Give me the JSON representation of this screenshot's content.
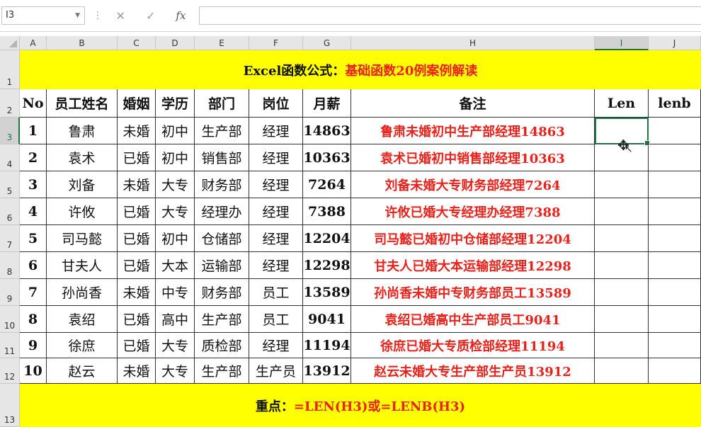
{
  "namebox": "I3",
  "formula": "",
  "fx": "fx",
  "columns": [
    "A",
    "B",
    "C",
    "D",
    "E",
    "F",
    "G",
    "H",
    "I",
    "J"
  ],
  "rows": [
    "1",
    "2",
    "3",
    "4",
    "5",
    "6",
    "7",
    "8",
    "9",
    "10",
    "11",
    "12",
    "13"
  ],
  "title": {
    "black": "Excel函数公式：",
    "red": "基础函数20例案例解读"
  },
  "headers": [
    "No",
    "员工姓名",
    "婚姻",
    "学历",
    "部门",
    "岗位",
    "月薪",
    "备注",
    "Len",
    "lenb"
  ],
  "data": [
    [
      "1",
      "鲁肃",
      "未婚",
      "初中",
      "生产部",
      "经理",
      "14863",
      "鲁肃未婚初中生产部经理14863"
    ],
    [
      "2",
      "袁术",
      "已婚",
      "初中",
      "销售部",
      "经理",
      "10363",
      "袁术已婚初中销售部经理10363"
    ],
    [
      "3",
      "刘备",
      "未婚",
      "大专",
      "财务部",
      "经理",
      "7264",
      "刘备未婚大专财务部经理7264"
    ],
    [
      "4",
      "许攸",
      "已婚",
      "大专",
      "经理办",
      "经理",
      "7388",
      "许攸已婚大专经理办经理7388"
    ],
    [
      "5",
      "司马懿",
      "已婚",
      "初中",
      "仓储部",
      "经理",
      "12204",
      "司马懿已婚初中仓储部经理12204"
    ],
    [
      "6",
      "甘夫人",
      "已婚",
      "大本",
      "运输部",
      "经理",
      "12298",
      "甘夫人已婚大本运输部经理12298"
    ],
    [
      "7",
      "孙尚香",
      "未婚",
      "中专",
      "财务部",
      "员工",
      "13589",
      "孙尚香未婚中专财务部员工13589"
    ],
    [
      "8",
      "袁绍",
      "已婚",
      "高中",
      "生产部",
      "员工",
      "9041",
      "袁绍已婚高中生产部员工9041"
    ],
    [
      "9",
      "徐庶",
      "已婚",
      "大专",
      "质检部",
      "经理",
      "11194",
      "徐庶已婚大专质检部经理11194"
    ],
    [
      "10",
      "赵云",
      "未婚",
      "大专",
      "生产部",
      "生产员",
      "13912",
      "赵云未婚大专生产部生产员13912"
    ]
  ],
  "footer": {
    "black": "重点：",
    "red": "=LEN(H3)或=LENB(H3)"
  },
  "selected_cell": "I3",
  "colors": {
    "banner": "#FFFF00",
    "red_text": "#E8221B",
    "selection": "#217346"
  }
}
